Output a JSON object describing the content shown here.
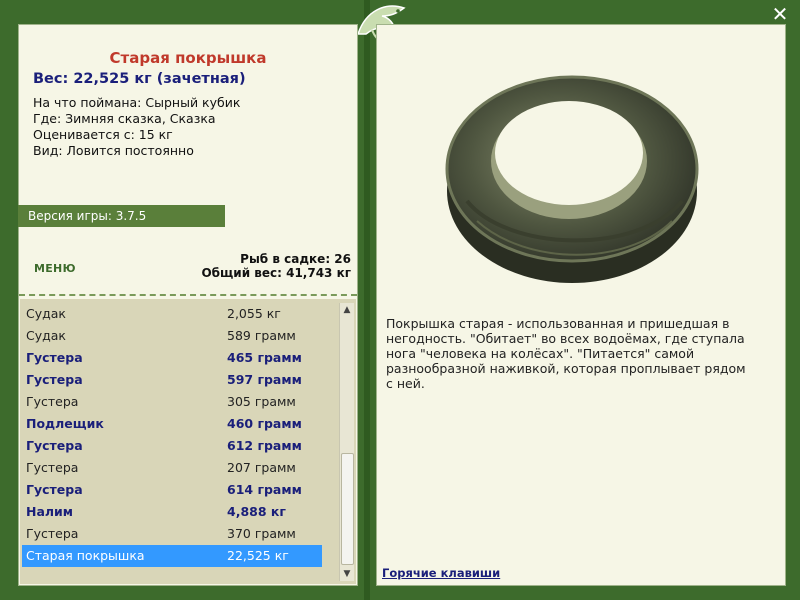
{
  "item": {
    "title": "Старая покрышка",
    "weight_line": "Вес: 22,525 кг (зачетная)",
    "info": [
      "На что поймана: Сырный кубик",
      "Где: Зимняя сказка, Сказка",
      "Оценивается с: 15 кг",
      "Вид: Ловится постоянно"
    ]
  },
  "version": "Версия игры: 3.7.5",
  "menu_label": "МЕНЮ",
  "stats": {
    "fish_count": "Рыб в садке: 26",
    "total_weight": "Общий вес: 41,743 кг"
  },
  "fish_list": [
    {
      "name": "Судак",
      "weight": "2,055 кг",
      "style": "normal"
    },
    {
      "name": "Судак",
      "weight": "589 грамм",
      "style": "normal"
    },
    {
      "name": "Густера",
      "weight": "465 грамм",
      "style": "bold"
    },
    {
      "name": "Густера",
      "weight": "597 грамм",
      "style": "bold"
    },
    {
      "name": "Густера",
      "weight": "305 грамм",
      "style": "normal"
    },
    {
      "name": "Подлещик",
      "weight": "460 грамм",
      "style": "bold"
    },
    {
      "name": "Густера",
      "weight": "612 грамм",
      "style": "bold"
    },
    {
      "name": "Густера",
      "weight": "207 грамм",
      "style": "normal"
    },
    {
      "name": "Густера",
      "weight": "614 грамм",
      "style": "bold"
    },
    {
      "name": "Налим",
      "weight": "4,888 кг",
      "style": "bold"
    },
    {
      "name": "Густера",
      "weight": "370 грамм",
      "style": "normal"
    },
    {
      "name": "Старая покрышка",
      "weight": "22,525 кг",
      "style": "selected"
    }
  ],
  "description": "Покрышка старая - использованная и пришедшая в негодность. \"Обитает\" во всех водоёмах, где ступала нога \"человека на колёсах\". \"Питается\" самой разнообразной наживкой, которая проплывает рядом с ней.",
  "hotkeys_label": "Горячие клавиши",
  "colors": {
    "frame": "#3d6b2c",
    "panel": "#f6f6e6",
    "list_bg": "#d9d6b8",
    "title": "#c0392b",
    "bold_text": "#1a1f7a",
    "selection": "#3399ff"
  },
  "icons": {
    "logo": "leaf-fish-logo-icon",
    "close": "close-icon",
    "image": "old-tire-image"
  }
}
